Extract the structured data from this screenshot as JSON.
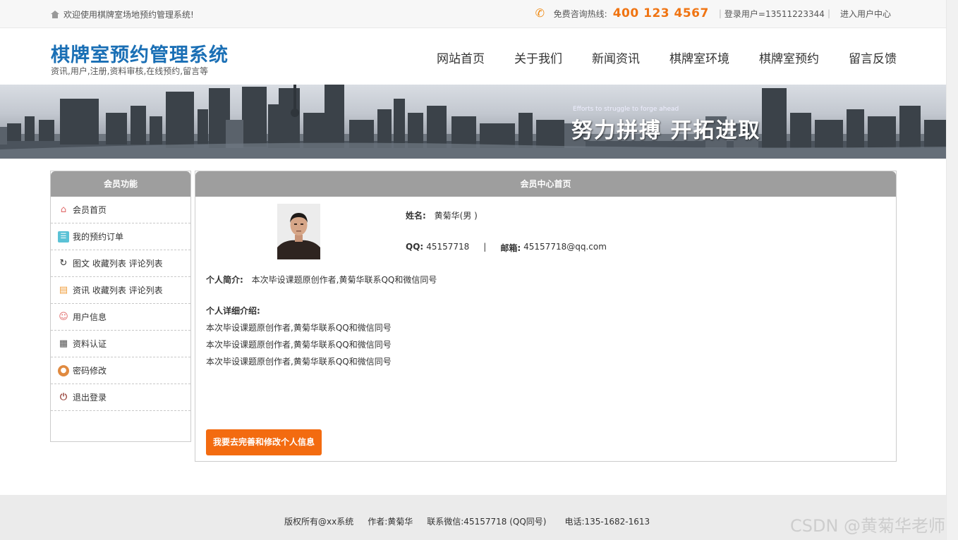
{
  "topbar": {
    "welcome": "欢迎使用棋牌室场地预约管理系统!",
    "hotline_label": "免费咨询热线:",
    "hotline_number": "400 123 4567",
    "login_user": "登录用户=13511223344",
    "sep": "|",
    "user_center": "进入用户中心"
  },
  "header": {
    "title": "棋牌室预约管理系统",
    "subtitle": "资讯,用户,注册,资料审核,在线预约,留言等",
    "nav": [
      "网站首页",
      "关于我们",
      "新闻资讯",
      "棋牌室环境",
      "棋牌室预约",
      "留言反馈"
    ]
  },
  "banner": {
    "en": "Efforts to struggle to forge ahead",
    "cn": "努力拼搏 开拓进取"
  },
  "sidebar": {
    "title": "会员功能",
    "items": [
      {
        "label": "会员首页",
        "icon": "home-icon"
      },
      {
        "label": "我的预约订单",
        "icon": "clipboard-icon"
      },
      {
        "label": "图文 收藏列表 评论列表",
        "icon": "history-icon"
      },
      {
        "label": "资讯 收藏列表 评论列表",
        "icon": "document-icon"
      },
      {
        "label": "用户信息",
        "icon": "user-icon"
      },
      {
        "label": "资料认证",
        "icon": "grid-icon"
      },
      {
        "label": "密码修改",
        "icon": "lock-icon"
      },
      {
        "label": "退出登录",
        "icon": "power-icon"
      }
    ]
  },
  "main": {
    "title": "会员中心首页",
    "name_label": "姓名:",
    "name_value": "黄菊华(男 )",
    "qq_label": "QQ:",
    "qq_value": "45157718",
    "email_label": "邮箱:",
    "email_value": "45157718@qq.com",
    "intro_label": "个人简介:",
    "intro_value": "本次毕设课题原创作者,黄菊华联系QQ和微信同号",
    "detail_title": "个人详细介绍:",
    "detail_lines": [
      "本次毕设课题原创作者,黄菊华联系QQ和微信同号",
      "本次毕设课题原创作者,黄菊华联系QQ和微信同号",
      "本次毕设课题原创作者,黄菊华联系QQ和微信同号"
    ],
    "edit_button": "我要去完善和修改个人信息"
  },
  "footer": {
    "copyright": "版权所有@xx系统",
    "author": "作者:黄菊华",
    "wechat": "联系微信:45157718 (QQ同号)",
    "phone": "电话:135-1682-1613"
  },
  "watermark": "CSDN @黄菊华老师",
  "colors": {
    "brand_blue": "#1a6fb5",
    "hotline_orange": "#f07412",
    "button_orange": "#f36b10",
    "panel_head_gray": "#9e9e9e"
  }
}
